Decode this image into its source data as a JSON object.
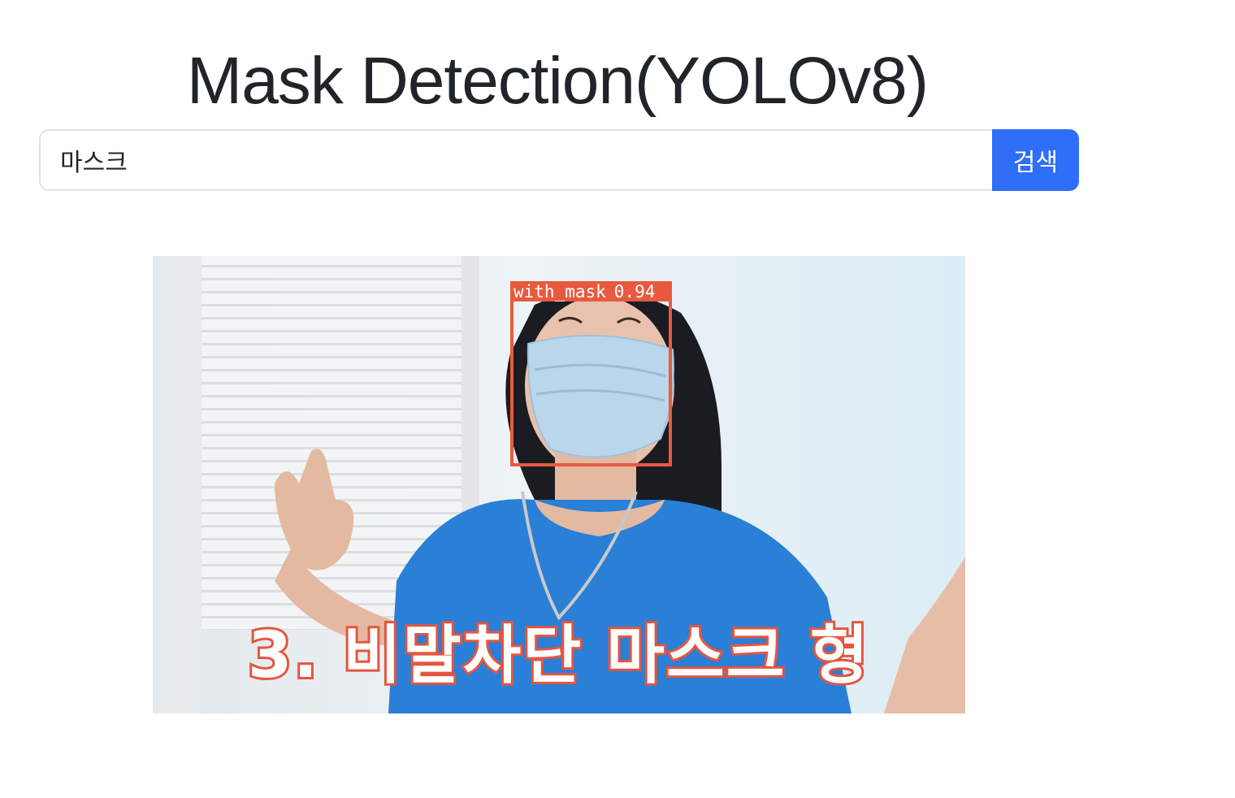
{
  "header": {
    "title": "Mask Detection(YOLOv8)"
  },
  "search": {
    "value": "마스크",
    "placeholder": "",
    "button_label": "검색"
  },
  "result": {
    "detection": {
      "label": "with_mask",
      "confidence": "0.94"
    },
    "caption": "3. 비말차단 마스크 형"
  },
  "colors": {
    "button": "#2f6ef7",
    "title": "#212529",
    "detection_box": "#e85a40"
  }
}
